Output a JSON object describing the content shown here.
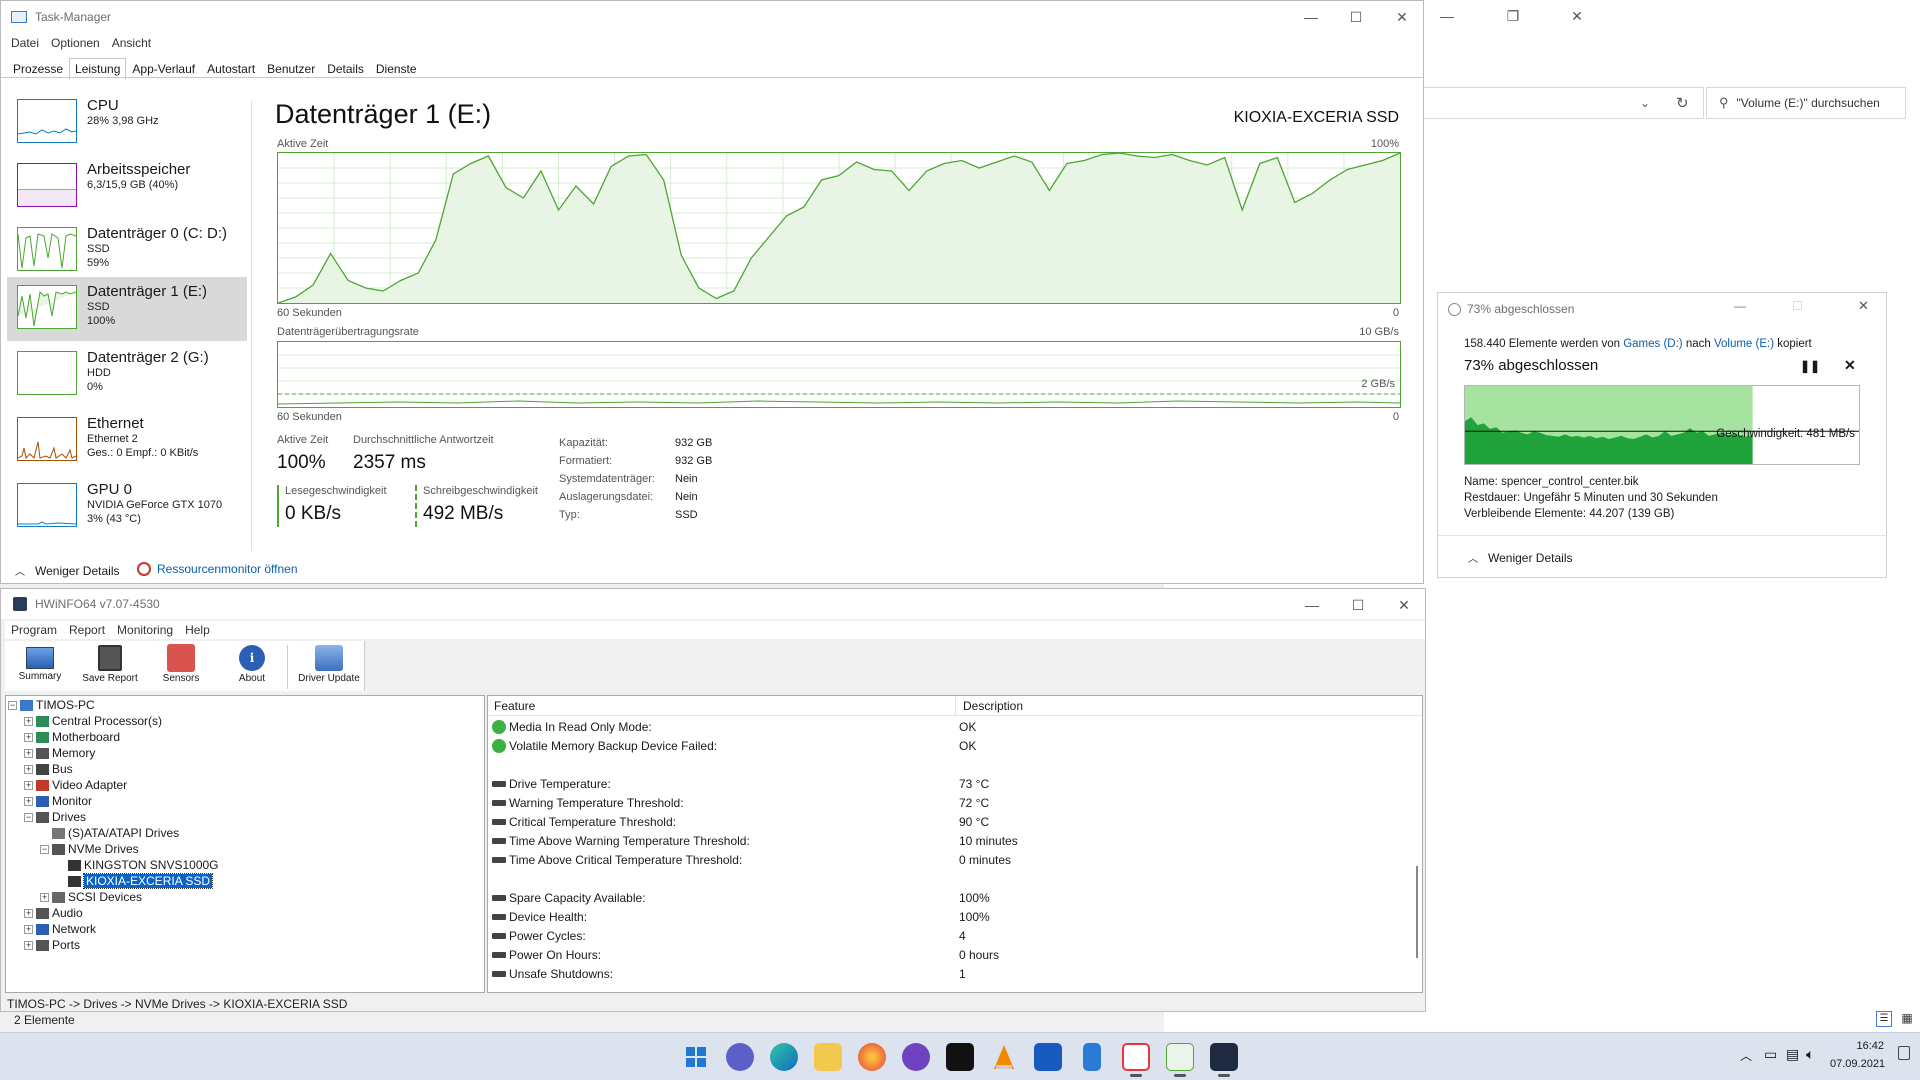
{
  "desktop_right": {
    "search_placeholder": "\"Volume (E:)\" durchsuchen",
    "status": "2 Elemente"
  },
  "taskmgr": {
    "title": "Task-Manager",
    "menu": [
      "Datei",
      "Optionen",
      "Ansicht"
    ],
    "tabs": [
      "Prozesse",
      "Leistung",
      "App-Verlauf",
      "Autostart",
      "Benutzer",
      "Details",
      "Dienste"
    ],
    "sidebar": [
      {
        "name": "CPU",
        "l1": "28% 3,98 GHz",
        "l2": "",
        "l3": ""
      },
      {
        "name": "Arbeitsspeicher",
        "l1": "6,3/15,9 GB (40%)",
        "l2": "",
        "l3": ""
      },
      {
        "name": "Datenträger 0 (C: D:)",
        "l1": "SSD",
        "l2": "59%",
        "l3": ""
      },
      {
        "name": "Datenträger 1 (E:)",
        "l1": "SSD",
        "l2": "100%",
        "l3": ""
      },
      {
        "name": "Datenträger 2 (G:)",
        "l1": "HDD",
        "l2": "0%",
        "l3": ""
      },
      {
        "name": "Ethernet",
        "l1": "Ethernet 2",
        "l2": "Ges.: 0 Empf.: 0 KBit/s",
        "l3": ""
      },
      {
        "name": "GPU 0",
        "l1": "NVIDIA GeForce GTX 1070",
        "l2": "3% (43 °C)",
        "l3": ""
      }
    ],
    "main": {
      "title": "Datenträger 1 (E:)",
      "device": "KIOXIA-EXCERIA SSD",
      "graph1_label": "Aktive Zeit",
      "graph1_max": "100%",
      "graph1_time": "60 Sekunden",
      "graph1_min": "0",
      "graph2_label": "Datenträgerübertragungsrate",
      "graph2_max": "10 GB/s",
      "graph2_mid": "2 GB/s",
      "graph2_time": "60 Sekunden",
      "graph2_min": "0"
    },
    "stats": {
      "active_label": "Aktive Zeit",
      "active_value": "100%",
      "resp_label": "Durchschnittliche Antwortzeit",
      "resp_value": "2357 ms",
      "read_label": "Lesegeschwindigkeit",
      "read_value": "0 KB/s",
      "write_label": "Schreibgeschwindigkeit",
      "write_value": "492 MB/s",
      "props": [
        {
          "k": "Kapazität:",
          "v": "932 GB"
        },
        {
          "k": "Formatiert:",
          "v": "932 GB"
        },
        {
          "k": "Systemdatenträger:",
          "v": "Nein"
        },
        {
          "k": "Auslagerungsdatei:",
          "v": "Nein"
        },
        {
          "k": "Typ:",
          "v": "SSD"
        }
      ]
    },
    "footer": {
      "less": "Weniger Details",
      "resmon": "Ressourcenmonitor öffnen"
    },
    "active_series": [
      0,
      4,
      12,
      33,
      15,
      10,
      8,
      15,
      20,
      42,
      86,
      93,
      98,
      77,
      70,
      88,
      62,
      78,
      66,
      91,
      98,
      99,
      82,
      32,
      10,
      3,
      8,
      30,
      44,
      58,
      64,
      82,
      85,
      94,
      89,
      88,
      75,
      88,
      93,
      95,
      90,
      94,
      98,
      94,
      75,
      93,
      95,
      99,
      100,
      98,
      97,
      99,
      95,
      92,
      97,
      62,
      93,
      97,
      67,
      73,
      82,
      89,
      92,
      95,
      100
    ]
  },
  "copy": {
    "title": "73% abgeschlossen",
    "line1_a": "158.440 Elemente werden von ",
    "line1_src": "Games (D:)",
    "line1_b": " nach ",
    "line1_dst": "Volume (E:)",
    "line1_c": " kopiert",
    "heading": "73% abgeschlossen",
    "speed": "Geschwindigkeit: 481 MB/s",
    "progress": 0.73,
    "name_label": "Name:",
    "name_value": "spencer_control_center.bik",
    "rest_label": "Restdauer:",
    "rest_value": "Ungefähr 5 Minuten und 30 Sekunden",
    "remain_label": "Verbleibende Elemente:",
    "remain_value": "44.207 (139 GB)",
    "less": "Weniger Details"
  },
  "hwinfo": {
    "title": "HWiNFO64 v7.07-4530",
    "menu": [
      "Program",
      "Report",
      "Monitoring",
      "Help"
    ],
    "toolbar": [
      "Summary",
      "Save Report",
      "Sensors",
      "About",
      "Driver Update"
    ],
    "tree": [
      {
        "label": "TIMOS-PC",
        "level": 0,
        "exp": "−"
      },
      {
        "label": "Central Processor(s)",
        "level": 1,
        "exp": "+"
      },
      {
        "label": "Motherboard",
        "level": 1,
        "exp": "+"
      },
      {
        "label": "Memory",
        "level": 1,
        "exp": "+"
      },
      {
        "label": "Bus",
        "level": 1,
        "exp": "+"
      },
      {
        "label": "Video Adapter",
        "level": 1,
        "exp": "+"
      },
      {
        "label": "Monitor",
        "level": 1,
        "exp": "+"
      },
      {
        "label": "Drives",
        "level": 1,
        "exp": "−"
      },
      {
        "label": "(S)ATA/ATAPI Drives",
        "level": 2,
        "exp": ""
      },
      {
        "label": "NVMe Drives",
        "level": 2,
        "exp": "−"
      },
      {
        "label": "KINGSTON SNVS1000G",
        "level": 3,
        "exp": ""
      },
      {
        "label": "KIOXIA-EXCERIA SSD",
        "level": 3,
        "exp": "",
        "selected": true
      },
      {
        "label": "SCSI Devices",
        "level": 2,
        "exp": "+"
      },
      {
        "label": "Audio",
        "level": 1,
        "exp": "+"
      },
      {
        "label": "Network",
        "level": 1,
        "exp": "+"
      },
      {
        "label": "Ports",
        "level": 1,
        "exp": "+"
      }
    ],
    "col_feature": "Feature",
    "col_desc": "Description",
    "rows": [
      {
        "f": "Media In Read Only Mode:",
        "d": "OK",
        "icon": "ok"
      },
      {
        "f": "Volatile Memory Backup Device Failed:",
        "d": "OK",
        "icon": "ok"
      },
      {
        "f": "",
        "d": "",
        "icon": ""
      },
      {
        "f": "Drive Temperature:",
        "d": "73 °C",
        "icon": "drive"
      },
      {
        "f": "Warning Temperature Threshold:",
        "d": "72 °C",
        "icon": "drive"
      },
      {
        "f": "Critical Temperature Threshold:",
        "d": "90 °C",
        "icon": "drive"
      },
      {
        "f": "Time Above Warning Temperature Threshold:",
        "d": "10 minutes",
        "icon": "drive"
      },
      {
        "f": "Time Above Critical Temperature Threshold:",
        "d": "0 minutes",
        "icon": "drive"
      },
      {
        "f": "",
        "d": "",
        "icon": ""
      },
      {
        "f": "Spare Capacity Available:",
        "d": "100%",
        "icon": "drive"
      },
      {
        "f": "Device Health:",
        "d": "100%",
        "icon": "drive"
      },
      {
        "f": "Power Cycles:",
        "d": "4",
        "icon": "drive"
      },
      {
        "f": "Power On Hours:",
        "d": "0 hours",
        "icon": "drive"
      },
      {
        "f": "Unsafe Shutdowns:",
        "d": "1",
        "icon": "drive"
      }
    ],
    "status": "TIMOS-PC -> Drives -> NVMe Drives -> KIOXIA-EXCERIA SSD"
  },
  "taskbar": {
    "time": "16:42",
    "date": "07.09.2021",
    "icons": [
      "windows-start",
      "chat",
      "edge",
      "explorer",
      "firefox",
      "github",
      "vpn",
      "vlc",
      "word",
      "phone",
      "snipping",
      "perfmon",
      "hwinfo"
    ]
  }
}
